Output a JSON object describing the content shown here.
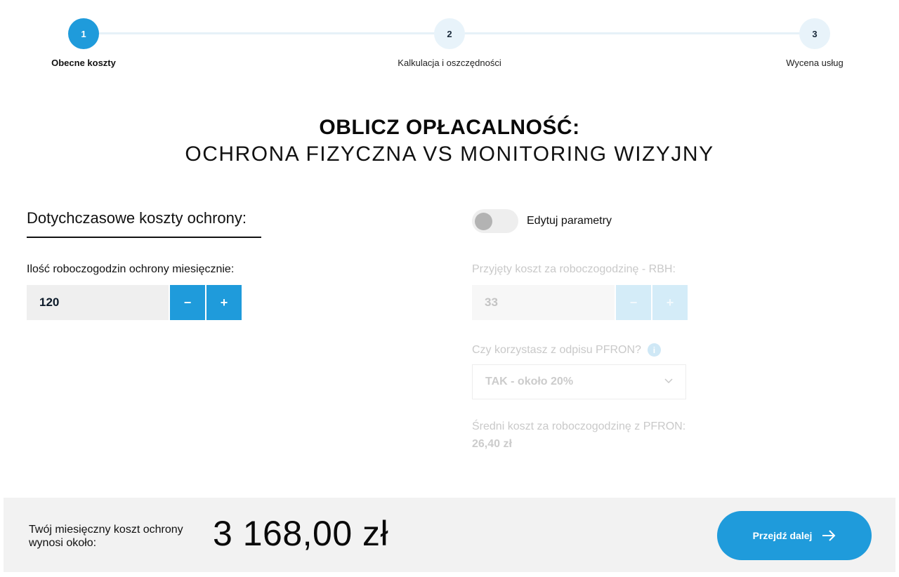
{
  "stepper": {
    "steps": [
      {
        "number": "1",
        "label": "Obecne koszty",
        "active": true
      },
      {
        "number": "2",
        "label": "Kalkulacja i oszczędności",
        "active": false
      },
      {
        "number": "3",
        "label": "Wycena usług",
        "active": false
      }
    ]
  },
  "title": {
    "main": "OBLICZ OPŁACALNOŚĆ:",
    "sub": "OCHRONA FIZYCZNA VS MONITORING WIZYJNY"
  },
  "left": {
    "heading": "Dotychczasowe koszty ochrony:",
    "hours_label": "Ilość roboczogodzin ochrony miesięcznie:",
    "hours_value": "120",
    "minus": "−",
    "plus": "+"
  },
  "right": {
    "toggle_label": "Edytuj parametry",
    "toggle_on": false,
    "rbh_label": "Przyjęty koszt za roboczogodzinę - RBH:",
    "rbh_value": "33",
    "minus": "−",
    "plus": "+",
    "pfron_label": "Czy korzystasz z odpisu PFRON?",
    "pfron_selected": "TAK - około 20%",
    "avg_label": "Średni koszt za roboczogodzinę z PFRON:",
    "avg_value": "26,40 zł"
  },
  "footer": {
    "label": "Twój miesięczny koszt ochrony wynosi około:",
    "amount": "3 168,00 zł",
    "next_label": "Przejdź dalej"
  },
  "colors": {
    "accent": "#1f9bdb",
    "accent_light": "#e8f3fa",
    "footer_bg": "#f2f2f2"
  }
}
